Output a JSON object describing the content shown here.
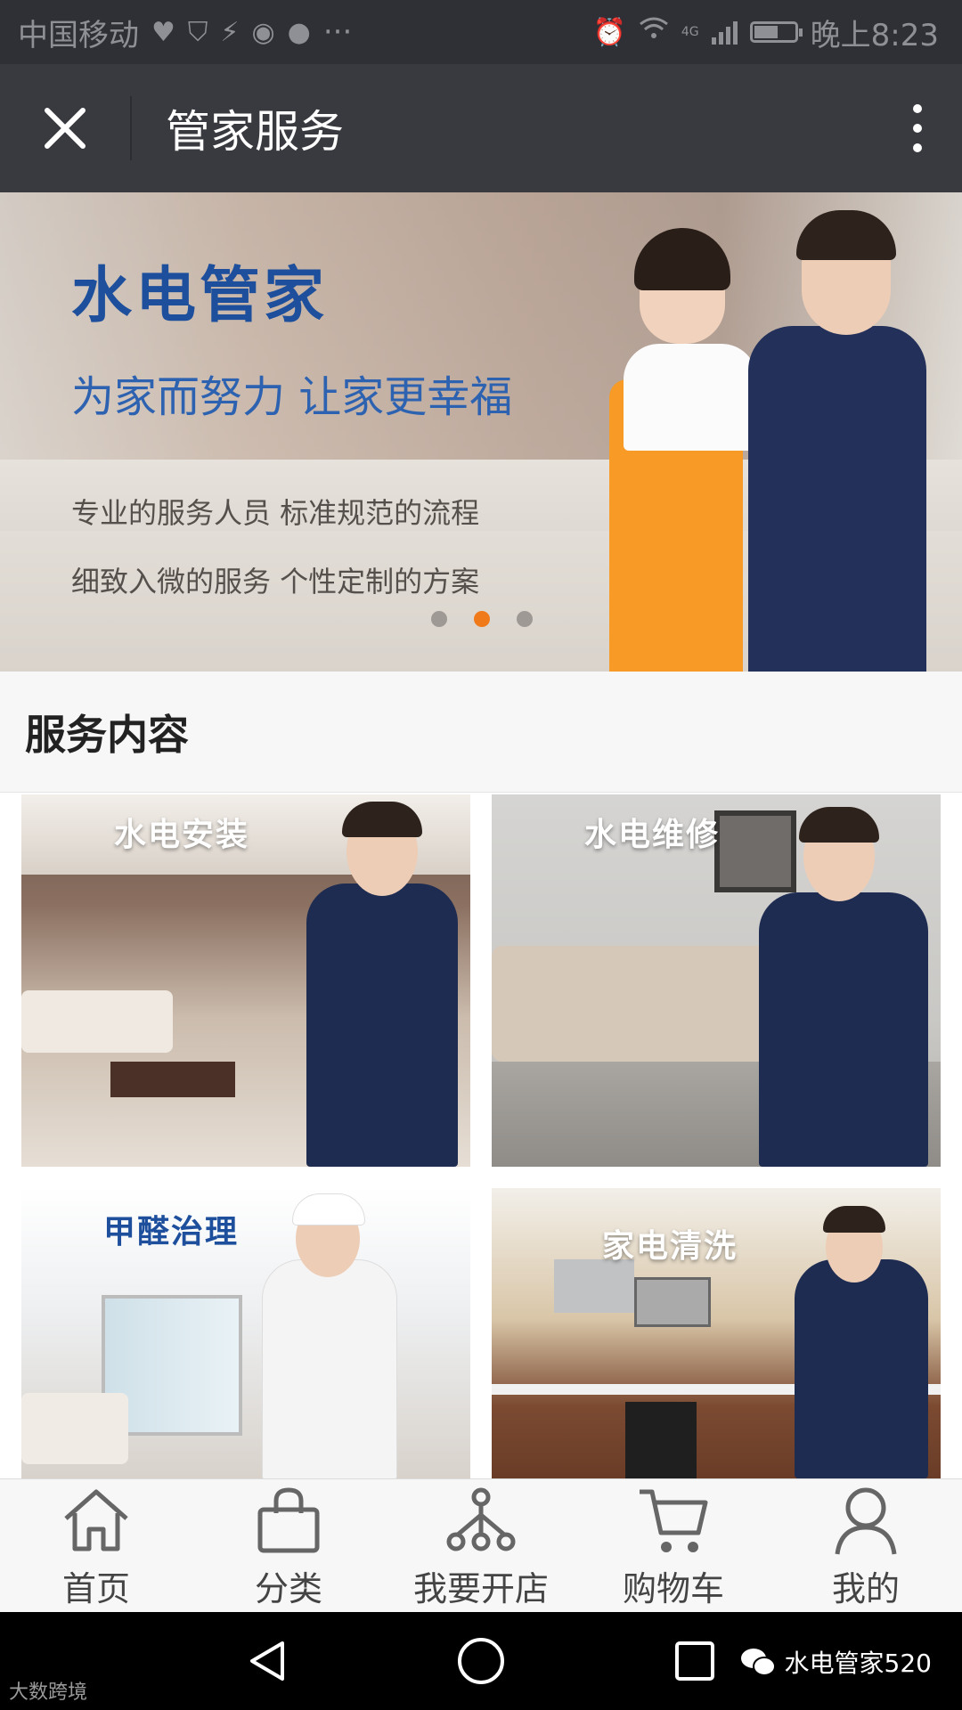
{
  "status_bar": {
    "carrier": "中国移动",
    "extra": "···",
    "network": "4G",
    "time": "晚上8:23",
    "battery_level": 0.55
  },
  "nav_bar": {
    "title": "管家服务"
  },
  "banner": {
    "brand": "水电管家",
    "slogan": "为家而努力 让家更幸福",
    "line1": "专业的服务人员  标准规范的流程",
    "line2": "细致入微的服务  个性定制的方案",
    "active_slide": 2,
    "slide_count": 3
  },
  "section": {
    "title": "服务内容"
  },
  "services": [
    {
      "label": "水电安装",
      "color": "#ffffff"
    },
    {
      "label": "水电维修",
      "color": "#ffffff"
    },
    {
      "label": "甲醛治理",
      "color": "#1d4f9c"
    },
    {
      "label": "家电清洗",
      "color": "#ffffff"
    }
  ],
  "tabs": [
    {
      "label": "首页",
      "icon": "home-icon"
    },
    {
      "label": "分类",
      "icon": "bag-icon"
    },
    {
      "label": "我要开店",
      "icon": "store-network-icon"
    },
    {
      "label": "购物车",
      "icon": "cart-icon"
    },
    {
      "label": "我的",
      "icon": "user-icon"
    }
  ],
  "watermark": {
    "account": "水电管家520",
    "corner": "大数跨境"
  },
  "colors": {
    "nav_bg": "#393a3f",
    "accent": "#f07a1a",
    "brand_blue": "#1d4f9c"
  }
}
